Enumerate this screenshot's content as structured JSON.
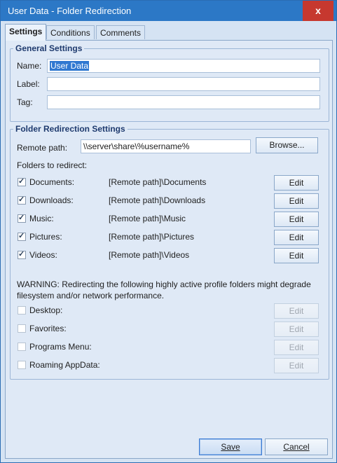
{
  "window": {
    "title": "User Data - Folder Redirection",
    "close_label": "x"
  },
  "tabs": [
    {
      "label": "Settings",
      "active": true
    },
    {
      "label": "Conditions",
      "active": false
    },
    {
      "label": "Comments",
      "active": false
    }
  ],
  "general": {
    "legend": "General Settings",
    "name_label": "Name:",
    "name_value": "User Data",
    "label_label": "Label:",
    "label_value": "",
    "tag_label": "Tag:",
    "tag_value": ""
  },
  "redirection": {
    "legend": "Folder Redirection Settings",
    "remote_label": "Remote path:",
    "remote_value": "\\\\server\\share\\%username%",
    "browse_label": "Browse...",
    "folders_label": "Folders to redirect:",
    "folders": [
      {
        "label": "Documents:",
        "path": "[Remote path]\\Documents",
        "checked": true,
        "edit": "Edit"
      },
      {
        "label": "Downloads:",
        "path": "[Remote path]\\Downloads",
        "checked": true,
        "edit": "Edit"
      },
      {
        "label": "Music:",
        "path": "[Remote path]\\Music",
        "checked": true,
        "edit": "Edit"
      },
      {
        "label": "Pictures:",
        "path": "[Remote path]\\Pictures",
        "checked": true,
        "edit": "Edit"
      },
      {
        "label": "Videos:",
        "path": "[Remote path]\\Videos",
        "checked": true,
        "edit": "Edit"
      }
    ],
    "warning": "WARNING: Redirecting the following highly active profile folders might degrade filesystem and/or network performance.",
    "risky_folders": [
      {
        "label": "Desktop:",
        "checked": false,
        "edit": "Edit"
      },
      {
        "label": "Favorites:",
        "checked": false,
        "edit": "Edit"
      },
      {
        "label": "Programs Menu:",
        "checked": false,
        "edit": "Edit"
      },
      {
        "label": "Roaming AppData:",
        "checked": false,
        "edit": "Edit"
      }
    ]
  },
  "footer": {
    "save_label": "Save",
    "cancel_label": "Cancel"
  },
  "colors": {
    "titlebar": "#2c78c6",
    "close": "#c6382f",
    "window_bg": "#d5e3f3"
  }
}
